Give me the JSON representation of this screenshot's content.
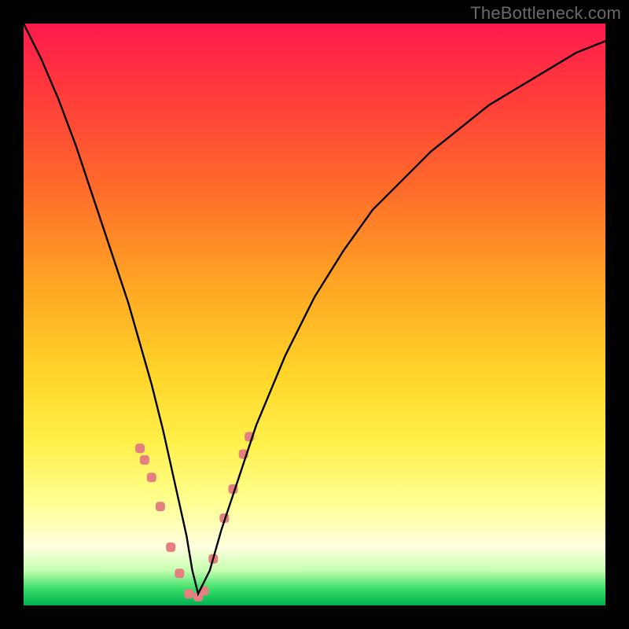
{
  "watermark": "TheBottleneck.com",
  "colors": {
    "curve": "#000000",
    "markers": "#e58080",
    "frame": "#000000"
  },
  "chart_data": {
    "type": "line",
    "title": "",
    "xlabel": "",
    "ylabel": "",
    "xlim": [
      0,
      100
    ],
    "ylim": [
      0,
      100
    ],
    "grid": false,
    "series": [
      {
        "name": "bottleneck-curve",
        "x": [
          0,
          3,
          6,
          9,
          12,
          15,
          18,
          20,
          22,
          24,
          26,
          28,
          29,
          30,
          32,
          34,
          37,
          40,
          45,
          50,
          55,
          60,
          65,
          70,
          75,
          80,
          85,
          90,
          95,
          100
        ],
        "values": [
          100,
          94,
          87,
          79,
          70,
          61,
          52,
          45,
          38,
          30,
          21,
          12,
          6,
          2,
          6,
          13,
          22,
          31,
          43,
          53,
          61,
          68,
          73,
          78,
          82,
          86,
          89,
          92,
          95,
          97
        ]
      }
    ],
    "markers": {
      "name": "highlighted-points",
      "x": [
        20.0,
        20.8,
        22.0,
        23.5,
        25.3,
        26.8,
        28.4,
        30.0,
        31.0,
        32.6,
        34.5,
        36.0,
        37.8,
        38.8
      ],
      "values": [
        27.0,
        25.0,
        22.0,
        17.0,
        10.0,
        5.5,
        2.0,
        1.5,
        2.5,
        8.0,
        15.0,
        20.0,
        26.0,
        29.0
      ]
    }
  }
}
